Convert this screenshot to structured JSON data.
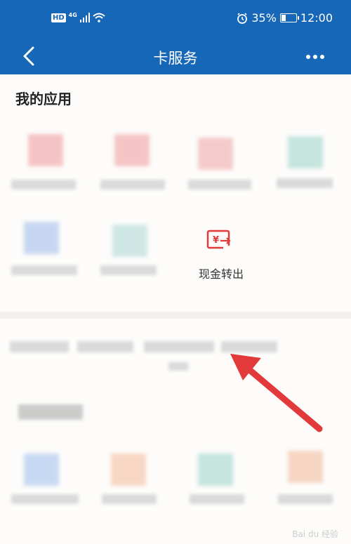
{
  "status_bar": {
    "hd": "HD",
    "network": "4G",
    "alarm_icon": "alarm-icon",
    "battery_percent": "35%",
    "battery_level": 0.35,
    "time": "12:00"
  },
  "nav": {
    "title": "卡服务",
    "back_icon": "chevron-left-icon",
    "more_icon": "more-icon"
  },
  "section": {
    "title": "我的应用"
  },
  "apps": {
    "highlighted_label": "现金转出",
    "highlighted_icon": "cash-transfer-icon"
  },
  "colors": {
    "brand_blue": "#1767b8",
    "accent_red": "#e23a3a"
  },
  "watermark": "Bai du 经验"
}
